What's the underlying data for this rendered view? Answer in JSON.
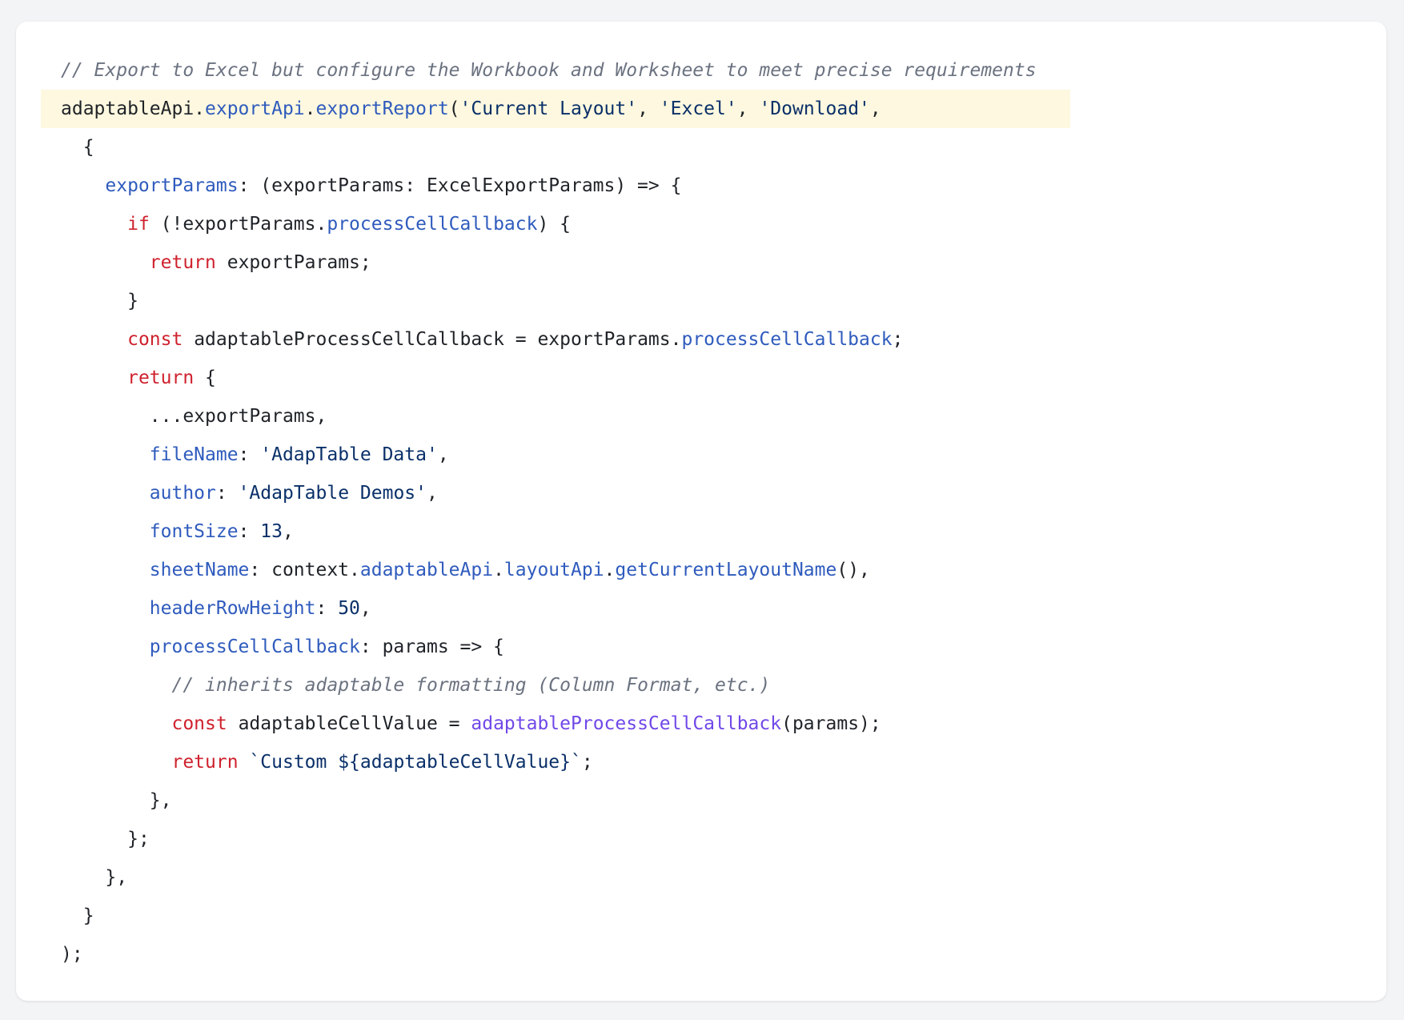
{
  "colors": {
    "background": "#f3f4f6",
    "card": "#ffffff",
    "highlight_line": "#fdf8df",
    "keyword": "#cf222e",
    "property": "#2f5bbd",
    "function": "#7048e8",
    "comment": "#6b7280",
    "string": "#0a3069",
    "plain": "#1f2328"
  },
  "highlighted_line": 2,
  "code_lines": [
    {
      "indent": 0,
      "tokens": [
        {
          "t": "comment",
          "v": "// Export to Excel but configure the Workbook and Worksheet to meet precise requirements"
        }
      ]
    },
    {
      "indent": 0,
      "tokens": [
        {
          "t": "plain",
          "v": "adaptableApi."
        },
        {
          "t": "prop",
          "v": "exportApi"
        },
        {
          "t": "plain",
          "v": "."
        },
        {
          "t": "prop",
          "v": "exportReport"
        },
        {
          "t": "plain",
          "v": "("
        },
        {
          "t": "str",
          "v": "'Current Layout'"
        },
        {
          "t": "plain",
          "v": ", "
        },
        {
          "t": "str",
          "v": "'Excel'"
        },
        {
          "t": "plain",
          "v": ", "
        },
        {
          "t": "str",
          "v": "'Download'"
        },
        {
          "t": "plain",
          "v": ","
        }
      ]
    },
    {
      "indent": 1,
      "tokens": [
        {
          "t": "plain",
          "v": "{"
        }
      ]
    },
    {
      "indent": 2,
      "tokens": [
        {
          "t": "prop",
          "v": "exportParams"
        },
        {
          "t": "plain",
          "v": ": (exportParams: ExcelExportParams) => {"
        }
      ]
    },
    {
      "indent": 3,
      "tokens": [
        {
          "t": "kw",
          "v": "if"
        },
        {
          "t": "plain",
          "v": " (!exportParams."
        },
        {
          "t": "prop",
          "v": "processCellCallback"
        },
        {
          "t": "plain",
          "v": ") {"
        }
      ]
    },
    {
      "indent": 4,
      "tokens": [
        {
          "t": "kw",
          "v": "return"
        },
        {
          "t": "plain",
          "v": " exportParams;"
        }
      ]
    },
    {
      "indent": 3,
      "tokens": [
        {
          "t": "plain",
          "v": "}"
        }
      ]
    },
    {
      "indent": 3,
      "tokens": [
        {
          "t": "kw",
          "v": "const"
        },
        {
          "t": "plain",
          "v": " adaptableProcessCellCallback = exportParams."
        },
        {
          "t": "prop",
          "v": "processCellCallback"
        },
        {
          "t": "plain",
          "v": ";"
        }
      ]
    },
    {
      "indent": 3,
      "tokens": [
        {
          "t": "kw",
          "v": "return"
        },
        {
          "t": "plain",
          "v": " {"
        }
      ]
    },
    {
      "indent": 4,
      "tokens": [
        {
          "t": "plain",
          "v": "...exportParams,"
        }
      ]
    },
    {
      "indent": 4,
      "tokens": [
        {
          "t": "prop",
          "v": "fileName"
        },
        {
          "t": "plain",
          "v": ": "
        },
        {
          "t": "str",
          "v": "'AdapTable Data'"
        },
        {
          "t": "plain",
          "v": ","
        }
      ]
    },
    {
      "indent": 4,
      "tokens": [
        {
          "t": "prop",
          "v": "author"
        },
        {
          "t": "plain",
          "v": ": "
        },
        {
          "t": "str",
          "v": "'AdapTable Demos'"
        },
        {
          "t": "plain",
          "v": ","
        }
      ]
    },
    {
      "indent": 4,
      "tokens": [
        {
          "t": "prop",
          "v": "fontSize"
        },
        {
          "t": "plain",
          "v": ": "
        },
        {
          "t": "num",
          "v": "13"
        },
        {
          "t": "plain",
          "v": ","
        }
      ]
    },
    {
      "indent": 4,
      "tokens": [
        {
          "t": "prop",
          "v": "sheetName"
        },
        {
          "t": "plain",
          "v": ": context."
        },
        {
          "t": "prop",
          "v": "adaptableApi"
        },
        {
          "t": "plain",
          "v": "."
        },
        {
          "t": "prop",
          "v": "layoutApi"
        },
        {
          "t": "plain",
          "v": "."
        },
        {
          "t": "prop",
          "v": "getCurrentLayoutName"
        },
        {
          "t": "plain",
          "v": "(),"
        }
      ]
    },
    {
      "indent": 4,
      "tokens": [
        {
          "t": "prop",
          "v": "headerRowHeight"
        },
        {
          "t": "plain",
          "v": ": "
        },
        {
          "t": "num",
          "v": "50"
        },
        {
          "t": "plain",
          "v": ","
        }
      ]
    },
    {
      "indent": 4,
      "tokens": [
        {
          "t": "prop",
          "v": "processCellCallback"
        },
        {
          "t": "plain",
          "v": ": params => {"
        }
      ]
    },
    {
      "indent": 5,
      "tokens": [
        {
          "t": "comment",
          "v": "// inherits adaptable formatting (Column Format, etc.)"
        }
      ]
    },
    {
      "indent": 5,
      "tokens": [
        {
          "t": "kw",
          "v": "const"
        },
        {
          "t": "plain",
          "v": " adaptableCellValue = "
        },
        {
          "t": "fn",
          "v": "adaptableProcessCellCallback"
        },
        {
          "t": "plain",
          "v": "(params);"
        }
      ]
    },
    {
      "indent": 5,
      "tokens": [
        {
          "t": "kw",
          "v": "return"
        },
        {
          "t": "plain",
          "v": " "
        },
        {
          "t": "str",
          "v": "`Custom ${adaptableCellValue}`"
        },
        {
          "t": "plain",
          "v": ";"
        }
      ]
    },
    {
      "indent": 4,
      "tokens": [
        {
          "t": "plain",
          "v": "},"
        }
      ]
    },
    {
      "indent": 3,
      "tokens": [
        {
          "t": "plain",
          "v": "};"
        }
      ]
    },
    {
      "indent": 2,
      "tokens": [
        {
          "t": "plain",
          "v": "},"
        }
      ]
    },
    {
      "indent": 1,
      "tokens": [
        {
          "t": "plain",
          "v": "}"
        }
      ]
    },
    {
      "indent": 0,
      "tokens": [
        {
          "t": "plain",
          "v": ");"
        }
      ]
    }
  ]
}
